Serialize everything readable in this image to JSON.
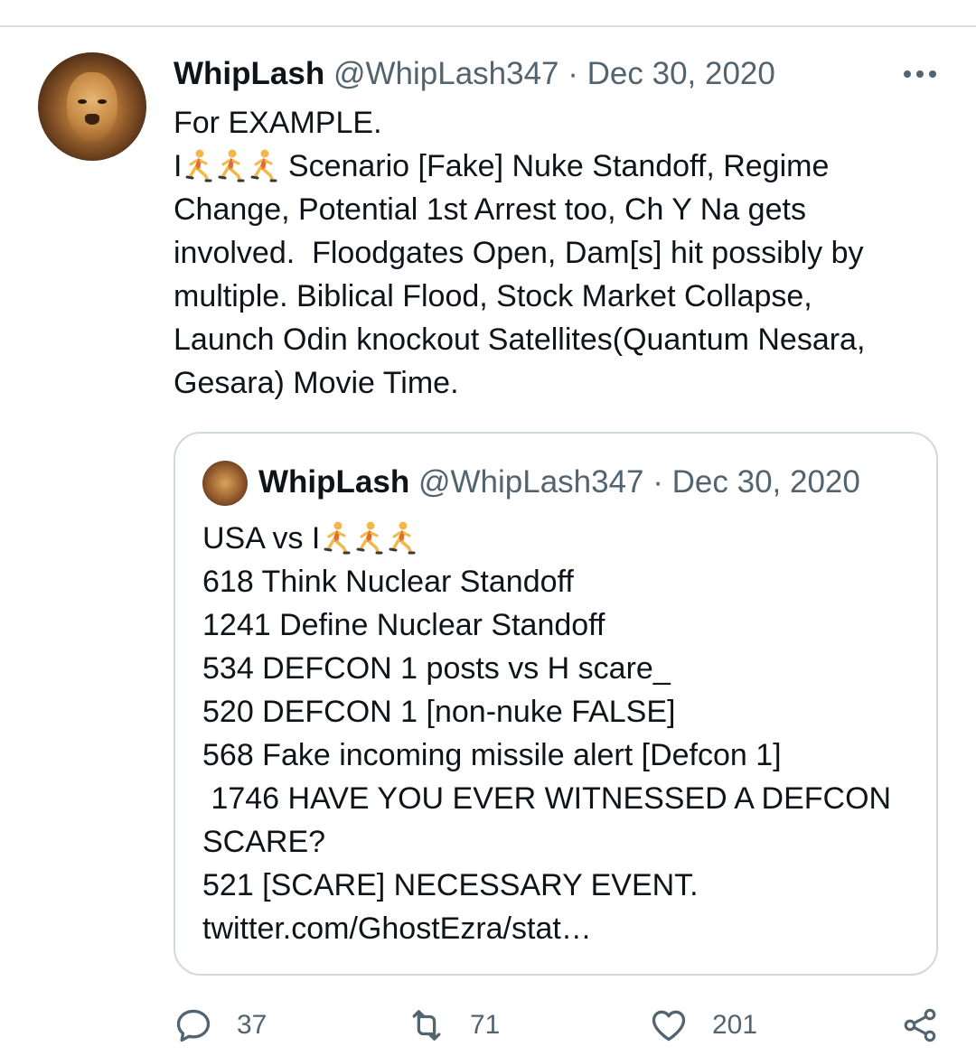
{
  "tweet": {
    "author_name": "WhipLash",
    "handle": "@WhipLash347",
    "separator": "·",
    "date": "Dec 30, 2020",
    "lines": [
      {
        "pre": "For EXAMPLE.",
        "runners": 0,
        "post": ""
      },
      {
        "pre": "I",
        "runners": 3,
        "post": " Scenario [Fake] Nuke Standoff, Regime"
      },
      {
        "pre": "Change, Potential 1st Arrest too, Ch Y Na gets",
        "runners": 0,
        "post": ""
      },
      {
        "pre": "involved.  Floodgates Open, Dam[s] hit possibly by",
        "runners": 0,
        "post": ""
      },
      {
        "pre": "multiple. Biblical Flood, Stock Market Collapse,",
        "runners": 0,
        "post": ""
      },
      {
        "pre": "Launch Odin knockout Satellites(Quantum Nesara,",
        "runners": 0,
        "post": ""
      },
      {
        "pre": "Gesara) Movie Time.",
        "runners": 0,
        "post": ""
      }
    ]
  },
  "quoted_tweet": {
    "author_name": "WhipLash",
    "handle": "@WhipLash347",
    "separator": "·",
    "date": "Dec 30, 2020",
    "lines": [
      {
        "pre": "USA vs I",
        "runners": 3,
        "post": ""
      },
      {
        "pre": "618 Think Nuclear Standoff",
        "runners": 0,
        "post": ""
      },
      {
        "pre": "1241 Define Nuclear Standoff",
        "runners": 0,
        "post": ""
      },
      {
        "pre": "534 DEFCON 1 posts vs H scare_",
        "runners": 0,
        "post": ""
      },
      {
        "pre": "520 DEFCON 1 [non-nuke FALSE]",
        "runners": 0,
        "post": ""
      },
      {
        "pre": "568 Fake incoming missile alert [Defcon 1]",
        "runners": 0,
        "post": ""
      },
      {
        "pre": " 1746 HAVE YOU EVER WITNESSED A DEFCON",
        "runners": 0,
        "post": ""
      },
      {
        "pre": "SCARE?",
        "runners": 0,
        "post": ""
      },
      {
        "pre": "521 [SCARE] NECESSARY EVENT.",
        "runners": 0,
        "post": ""
      },
      {
        "pre": "twitter.com/GhostEzra/stat…",
        "runners": 0,
        "post": ""
      }
    ]
  },
  "actions": {
    "replies": "37",
    "retweets": "71",
    "likes": "201"
  },
  "icons": {
    "reply": "reply-icon",
    "retweet": "retweet-icon",
    "like": "heart-icon",
    "share": "share-icon",
    "more": "more-icon",
    "runner": "person-running-emoji"
  },
  "colors": {
    "text": "#0f1419",
    "secondary": "#536471",
    "border": "#cfd9de"
  }
}
